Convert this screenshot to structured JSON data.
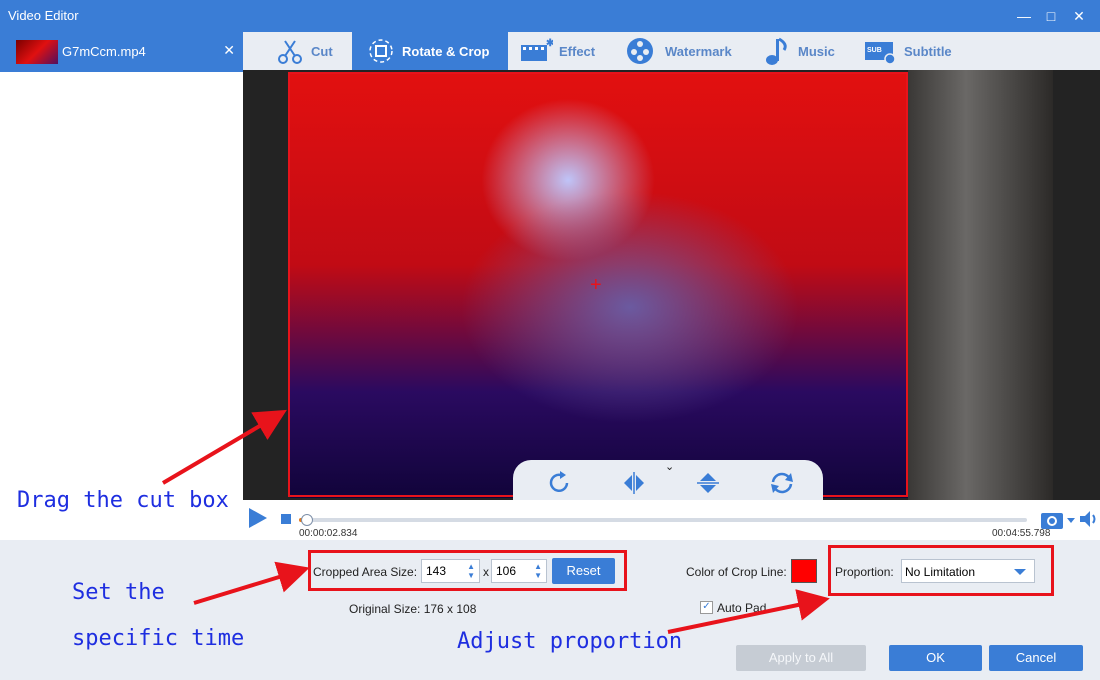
{
  "window": {
    "title": "Video Editor"
  },
  "file": {
    "name": "G7mCcm.mp4"
  },
  "tabs": [
    {
      "label": "Cut"
    },
    {
      "label": "Rotate & Crop"
    },
    {
      "label": "Effect"
    },
    {
      "label": "Watermark"
    },
    {
      "label": "Music"
    },
    {
      "label": "Subtitle"
    }
  ],
  "playback": {
    "current_time": "00:00:02.834",
    "total_time": "00:04:55.798",
    "progress": 0.0096
  },
  "crop": {
    "area_label": "Cropped Area Size:",
    "width": "143",
    "separator": "x",
    "height": "106",
    "reset_label": "Reset",
    "original_size": "Original Size: 176 x 108",
    "color_label": "Color of Crop Line:",
    "color": "#ff0000",
    "proportion_label": "Proportion:",
    "proportion_value": "No Limitation",
    "auto_pad_label": "Auto Pad"
  },
  "buttons": {
    "apply_all": "Apply to All",
    "ok": "OK",
    "cancel": "Cancel"
  },
  "annotations": {
    "drag": "Drag the cut box",
    "set1": "Set the",
    "set2": "specific time",
    "adjust": "Adjust proportion"
  }
}
